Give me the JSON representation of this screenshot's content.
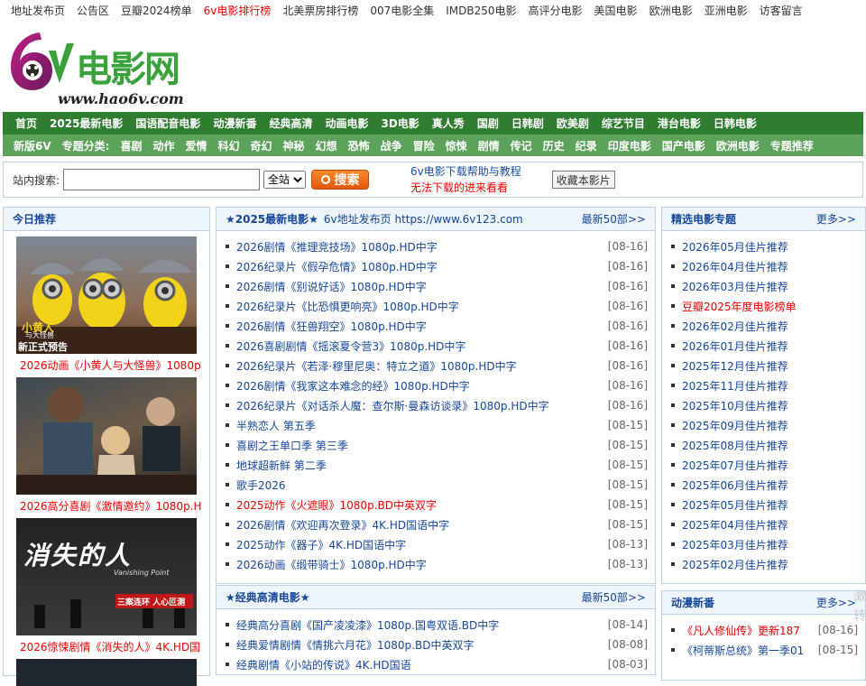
{
  "topnav": [
    "地址发布页",
    "公告区",
    "豆瓣2024榜单",
    "6v电影排行榜",
    "北美票房排行榜",
    "007电影全集",
    "IMDB250电影",
    "高评分电影",
    "美国电影",
    "欧洲电影",
    "亚洲电影",
    "访客留言"
  ],
  "logo": {
    "six": "6v",
    "cn": "电影网",
    "url": "www.hao6v.com"
  },
  "nav1": [
    "首页",
    "2025最新电影",
    "国语配音电影",
    "动漫新番",
    "经典高清",
    "动画电影",
    "3D电影",
    "真人秀",
    "国剧",
    "日韩剧",
    "欧美剧",
    "综艺节目",
    "港台电影",
    "日韩电影"
  ],
  "nav2": {
    "lead": "新版6V",
    "label": "专题分类:",
    "items": [
      "喜剧",
      "动作",
      "爱情",
      "科幻",
      "奇幻",
      "神秘",
      "幻想",
      "恐怖",
      "战争",
      "冒险",
      "惊悚",
      "剧情",
      "传记",
      "历史",
      "纪录",
      "印度电影",
      "国产电影",
      "欧洲电影",
      "专题推荐"
    ]
  },
  "search": {
    "label": "站内搜索:",
    "value": "",
    "select": "全站",
    "button": "搜索",
    "help1": "6v电影下载帮助与教程",
    "help2": "无法下载的进来看看",
    "fav": "收藏本影片"
  },
  "today": {
    "title": "今日推荐",
    "items": [
      {
        "caption": "2026动画《小黄人与大怪兽》1080p",
        "poster_text1": "小黄人",
        "poster_text2": "与大怪兽",
        "poster_text3": "新正式预告"
      },
      {
        "caption": "2026高分喜剧《激情邀约》1080p.H"
      },
      {
        "caption": "2026惊悚剧情《消失的人》4K.HD国",
        "poster_text1": "消失的人",
        "poster_text2": "Vanishing Point",
        "poster_text3": "三案连环 人心叵测"
      },
      {
        "caption": ""
      }
    ]
  },
  "latest": {
    "title": "★2025最新电影★",
    "sub": "6v地址发布页 https://www.6v123.com",
    "more": "最新50部>>",
    "items": [
      {
        "t": "2026剧情《推理竞技场》1080p.HD中字",
        "d": "[08-16]",
        "red": false
      },
      {
        "t": "2026纪录片《假孕危情》1080p.HD中字",
        "d": "[08-16]",
        "red": false
      },
      {
        "t": "2026剧情《别说好话》1080p.HD中字",
        "d": "[08-16]",
        "red": false
      },
      {
        "t": "2026纪录片《比恐惧更响亮》1080p.HD中字",
        "d": "[08-16]",
        "red": false
      },
      {
        "t": "2026剧情《狂兽翔空》1080p.HD中字",
        "d": "[08-16]",
        "red": false
      },
      {
        "t": "2026喜剧剧情《摇滚夏令营3》1080p.HD中字",
        "d": "[08-16]",
        "red": false
      },
      {
        "t": "2026纪录片《若泽·穆里尼奥：特立之道》1080p.HD中字",
        "d": "[08-16]",
        "red": false
      },
      {
        "t": "2026剧情《我家这本难念的经》1080p.HD中字",
        "d": "[08-16]",
        "red": false
      },
      {
        "t": "2026纪录片《对话杀人魔：查尔斯·曼森访谈录》1080p.HD中字",
        "d": "[08-16]",
        "red": false
      },
      {
        "t": "半熟恋人 第五季",
        "d": "[08-15]",
        "red": false
      },
      {
        "t": "喜剧之王单口季 第三季",
        "d": "[08-15]",
        "red": false
      },
      {
        "t": "地球超新鲜 第二季",
        "d": "[08-15]",
        "red": false
      },
      {
        "t": "歌手2026",
        "d": "[08-15]",
        "red": false
      },
      {
        "t": "2025动作《火遮眼》1080p.BD中英双字",
        "d": "[08-15]",
        "red": true
      },
      {
        "t": "2026剧情《欢迎再次登录》4K.HD国语中字",
        "d": "[08-15]",
        "red": false
      },
      {
        "t": "2025动作《器子》4K.HD国语中字",
        "d": "[08-13]",
        "red": false
      },
      {
        "t": "2026动画《缎带骑士》1080p.HD中字",
        "d": "[08-13]",
        "red": false
      }
    ]
  },
  "classic": {
    "title": "★经典高清电影★",
    "more": "最新50部>>",
    "items": [
      {
        "t": "经典高分喜剧《国产凌凌漆》1080p.国粤双语.BD中字",
        "d": "[08-14]"
      },
      {
        "t": "经典爱情剧情《情挑六月花》1080p.BD中英双字",
        "d": "[08-08]"
      },
      {
        "t": "经典剧情《小站的传说》4K.HD国语",
        "d": "[08-03]"
      }
    ]
  },
  "featured": {
    "title": "精选电影专题",
    "more": "更多>>",
    "items": [
      {
        "t": "2026年05月佳片推荐",
        "red": false
      },
      {
        "t": "2026年04月佳片推荐",
        "red": false
      },
      {
        "t": "2026年03月佳片推荐",
        "red": false
      },
      {
        "t": "豆瓣2025年度电影榜单",
        "red": true
      },
      {
        "t": "2026年02月佳片推荐",
        "red": false
      },
      {
        "t": "2026年01月佳片推荐",
        "red": false
      },
      {
        "t": "2025年12月佳片推荐",
        "red": false
      },
      {
        "t": "2025年11月佳片推荐",
        "red": false
      },
      {
        "t": "2025年10月佳片推荐",
        "red": false
      },
      {
        "t": "2025年09月佳片推荐",
        "red": false
      },
      {
        "t": "2025年08月佳片推荐",
        "red": false
      },
      {
        "t": "2025年07月佳片推荐",
        "red": false
      },
      {
        "t": "2025年06月佳片推荐",
        "red": false
      },
      {
        "t": "2025年05月佳片推荐",
        "red": false
      },
      {
        "t": "2025年04月佳片推荐",
        "red": false
      },
      {
        "t": "2025年03月佳片推荐",
        "red": false
      },
      {
        "t": "2025年02月佳片推荐",
        "red": false
      }
    ]
  },
  "anime": {
    "title": "动漫新番",
    "more": "更多>>",
    "items": [
      {
        "t": "《凡人修仙传》更新187",
        "d": "[08-16]",
        "red": true
      },
      {
        "t": "《柯蒂斯总统》第一季01",
        "d": "[08-15]",
        "red": false
      }
    ]
  },
  "watermark": {
    "l1": "激",
    "l2": "转"
  },
  "colors": {
    "navDark": "#2f7d2f",
    "navLight": "#5da25a",
    "link": "#15479a",
    "red": "#e00000",
    "logoGreen": "#3aa23a",
    "logoPurple": "#8a1a6b"
  }
}
